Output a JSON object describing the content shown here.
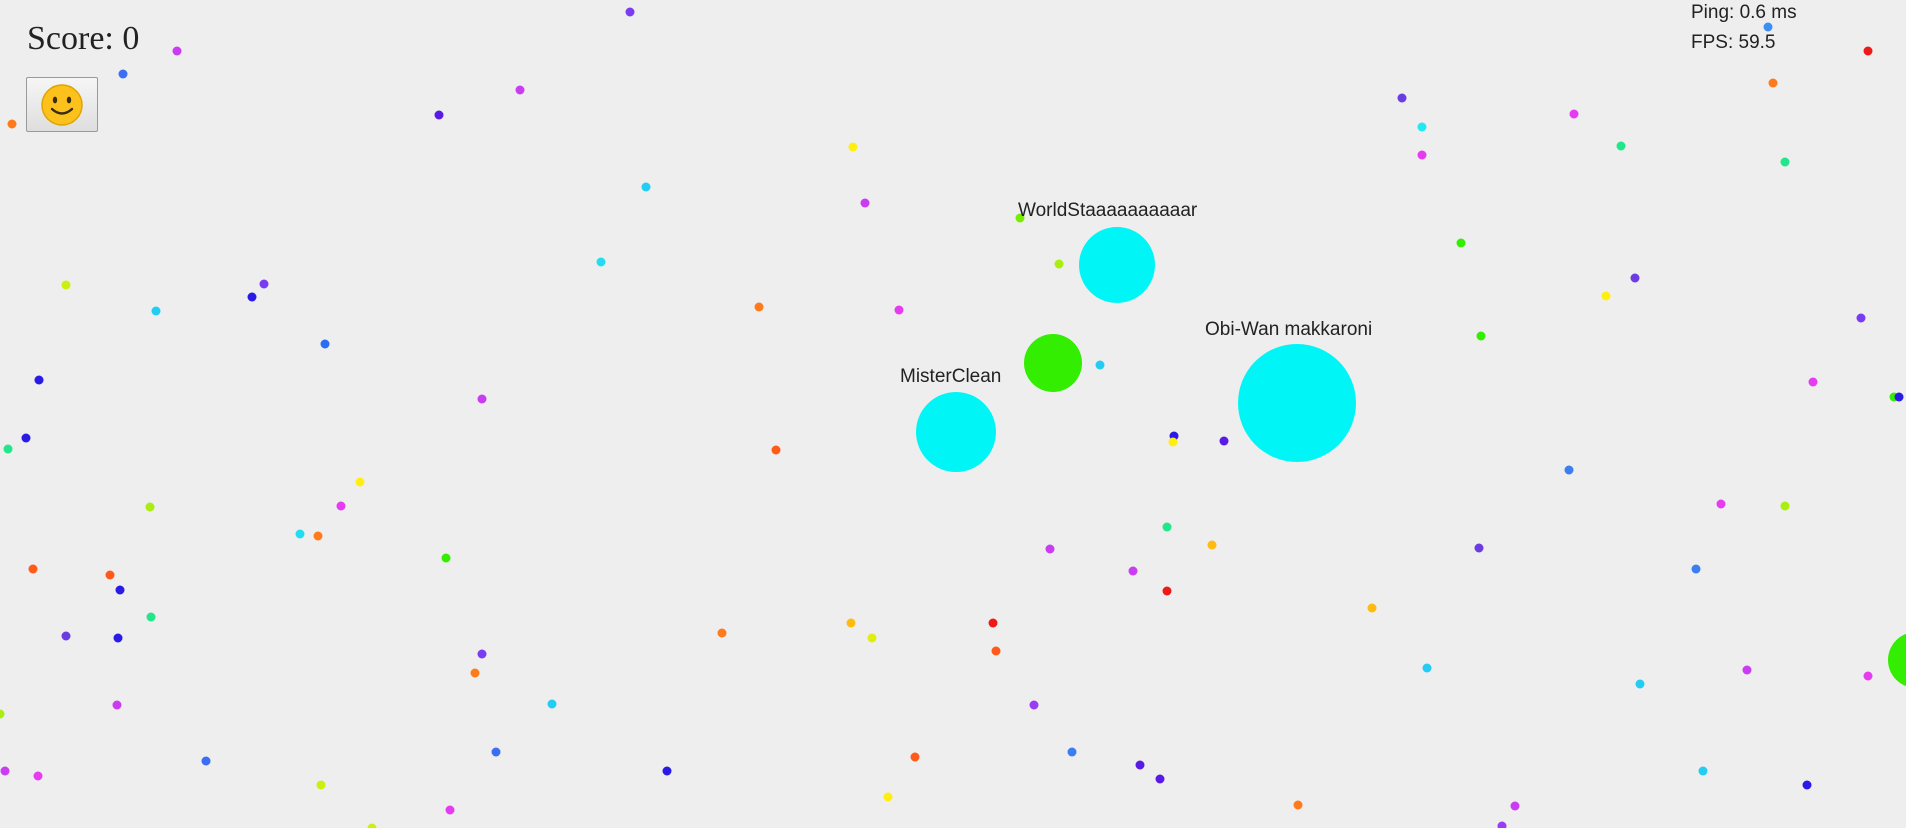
{
  "hud": {
    "score_label": "Score: 0",
    "emoji_button_icon": "smiley-face-icon",
    "ping_label": "Ping: 0.6 ms",
    "fps_label": "FPS: 59.5"
  },
  "players": [
    {
      "name": "WorldStaaaaaaaaaar",
      "color": "#00f6f6"
    },
    {
      "name": "MisterClean",
      "color": "#00f6f6"
    },
    {
      "name": "Obi-Wan makkaroni",
      "color": "#00f6f6"
    },
    {
      "name": "",
      "color": "#33ee00"
    },
    {
      "name": "",
      "color": "#33ee00"
    }
  ],
  "colors": {
    "background": "#eeeeee",
    "player_cell": "#00f6f6",
    "green_cell": "#33ee00"
  }
}
